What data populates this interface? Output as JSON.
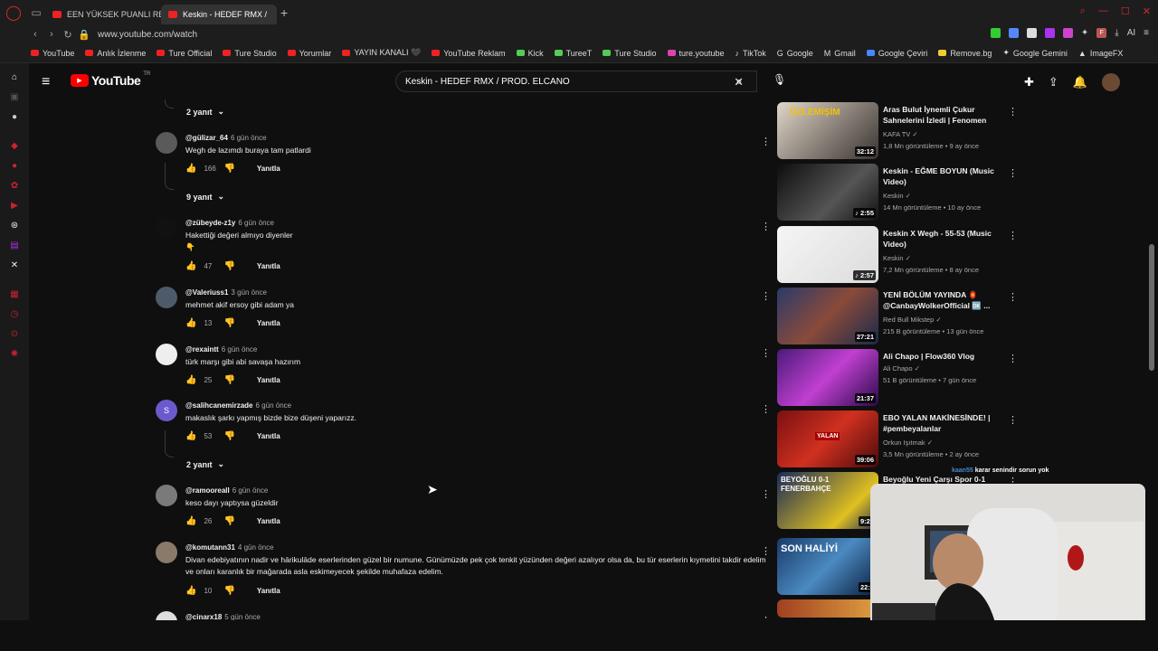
{
  "browser": {
    "tabs": [
      {
        "label": "EEN YÜKSEK PUANLI RES",
        "active": false
      },
      {
        "label": "Keskin - HEDEF RMX /",
        "active": true
      }
    ],
    "url": "www.youtube.com/watch",
    "ext_label": "AI",
    "profile_letter": "F",
    "bookmarks": [
      "YouTube",
      "Anlık İzlenme",
      "Ture Official",
      "Ture Studio",
      "Yorumlar",
      "YAYIN KANALI 🖤",
      "YouTube Reklam",
      "Kick",
      "TureeT",
      "Ture Studio",
      "ture.youtube",
      "TikTok",
      "Google",
      "Gmail",
      "Google Çeviri",
      "Remove.bg",
      "Google Gemini",
      "ImageFX"
    ]
  },
  "youtube": {
    "logo_text": "YouTube",
    "country": "TR",
    "search_value": "Keskin - HEDEF RMX / PROD. ELCANO"
  },
  "comments": {
    "replies_top": "2 yanıt",
    "reply_label": "Yanıtla",
    "items": [
      {
        "author": "@gülizar_64",
        "date": "6 gün önce",
        "text": "Wegh de lazımdı buraya tam patlardi",
        "likes": "166",
        "replies": "9 yanıt"
      },
      {
        "author": "@zübeyde-z1y",
        "date": "6 gün önce",
        "text": "Hakettiği değeri almıyo diyenler",
        "emoji": "👇",
        "likes": "47",
        "replies": ""
      },
      {
        "author": "@Valeriuss1",
        "date": "3 gün önce",
        "text": "mehmet akif ersoy gibi adam ya",
        "likes": "13",
        "replies": ""
      },
      {
        "author": "@rexaintt",
        "date": "6 gün önce",
        "text": "türk marşı gibi abi savaşa hazırım",
        "likes": "25",
        "replies": ""
      },
      {
        "author": "@salihcanemirzade",
        "date": "6 gün önce",
        "text": "makaslık şarkı yapmış bizde bize düşeni yaparızz.",
        "likes": "53",
        "replies": "2 yanıt",
        "initial": "S"
      },
      {
        "author": "@ramooreall",
        "date": "6 gün önce",
        "text": "keso dayı yaptıysa güzeldir",
        "likes": "26",
        "replies": ""
      },
      {
        "author": "@komutann31",
        "date": "4 gün önce",
        "text": "Divan edebiyatının nadir ve hārikulāde eserlerinden güzel bir numune. Günümüzde pek çok tenkit yüzünden değeri azalıyor olsa da, bu tür eserlerin kıymetini takdir edelim ve onları karanlık bir mağarada asla eskimeyecek şekilde muhafaza edelim.",
        "likes": "10",
        "replies": ""
      },
      {
        "author": "@cinarx18",
        "date": "5 gün önce",
        "text": "",
        "likes": "",
        "replies": ""
      }
    ]
  },
  "recommendations": [
    {
      "title": "Aras Bulut İynemli Çukur Sahnelerini İzledi | Fenomen",
      "channel": "KAFA TV",
      "meta": "1,8 Mn görüntüleme • 9 ay önce",
      "duration": "32:12",
      "thumb_text": "ÖZLEMİŞİM"
    },
    {
      "title": "Keskin - EĞME BOYUN (Music Video)",
      "channel": "Keskin",
      "meta": "14 Mn görüntüleme • 10 ay önce",
      "duration": "2:55",
      "thumb_text": ""
    },
    {
      "title": "Keskin X Wegh - 55-53 (Music Video)",
      "channel": "Keskin",
      "meta": "7,2 Mn görüntüleme • 8 ay önce",
      "duration": "2:57",
      "thumb_text": ""
    },
    {
      "title": "YENİ BÖLÜM YAYINDA 🏮 @CanbayWolkerOfficial 🆗 ...",
      "channel": "Red Bull Mikstep",
      "meta": "215 B görüntüleme • 13 gün önce",
      "duration": "27:21",
      "thumb_text": ""
    },
    {
      "title": "Ali Chapo | Flow360 Vlog",
      "channel": "Ali Chapo",
      "meta": "51 B görüntüleme • 7 gün önce",
      "duration": "21:37",
      "thumb_text": ""
    },
    {
      "title": "EBO YALAN MAKİNESİNDE! | #pembeyalanlar",
      "channel": "Orkun Işıtmak",
      "meta": "3,5 Mn görüntüleme • 2 ay önce",
      "duration": "39:06",
      "thumb_text": "YALAN"
    },
    {
      "title": "Beyoğlu Yeni Çarşı Spor 0-1",
      "channel": "",
      "meta": "",
      "duration": "9:21",
      "thumb_text": "BEYOĞLU 0-1 FENERBAHÇE"
    },
    {
      "title": "",
      "channel": "",
      "meta": "",
      "duration": "22:5",
      "thumb_text": "SON HALİYİ"
    }
  ],
  "stream_overlay": {
    "user": "kaan55",
    "message": "karar senindir sorun yok"
  },
  "colors": {
    "yt_red": "#ff0000",
    "bg": "#0f0f0f",
    "opera_red": "#d02a2a"
  }
}
